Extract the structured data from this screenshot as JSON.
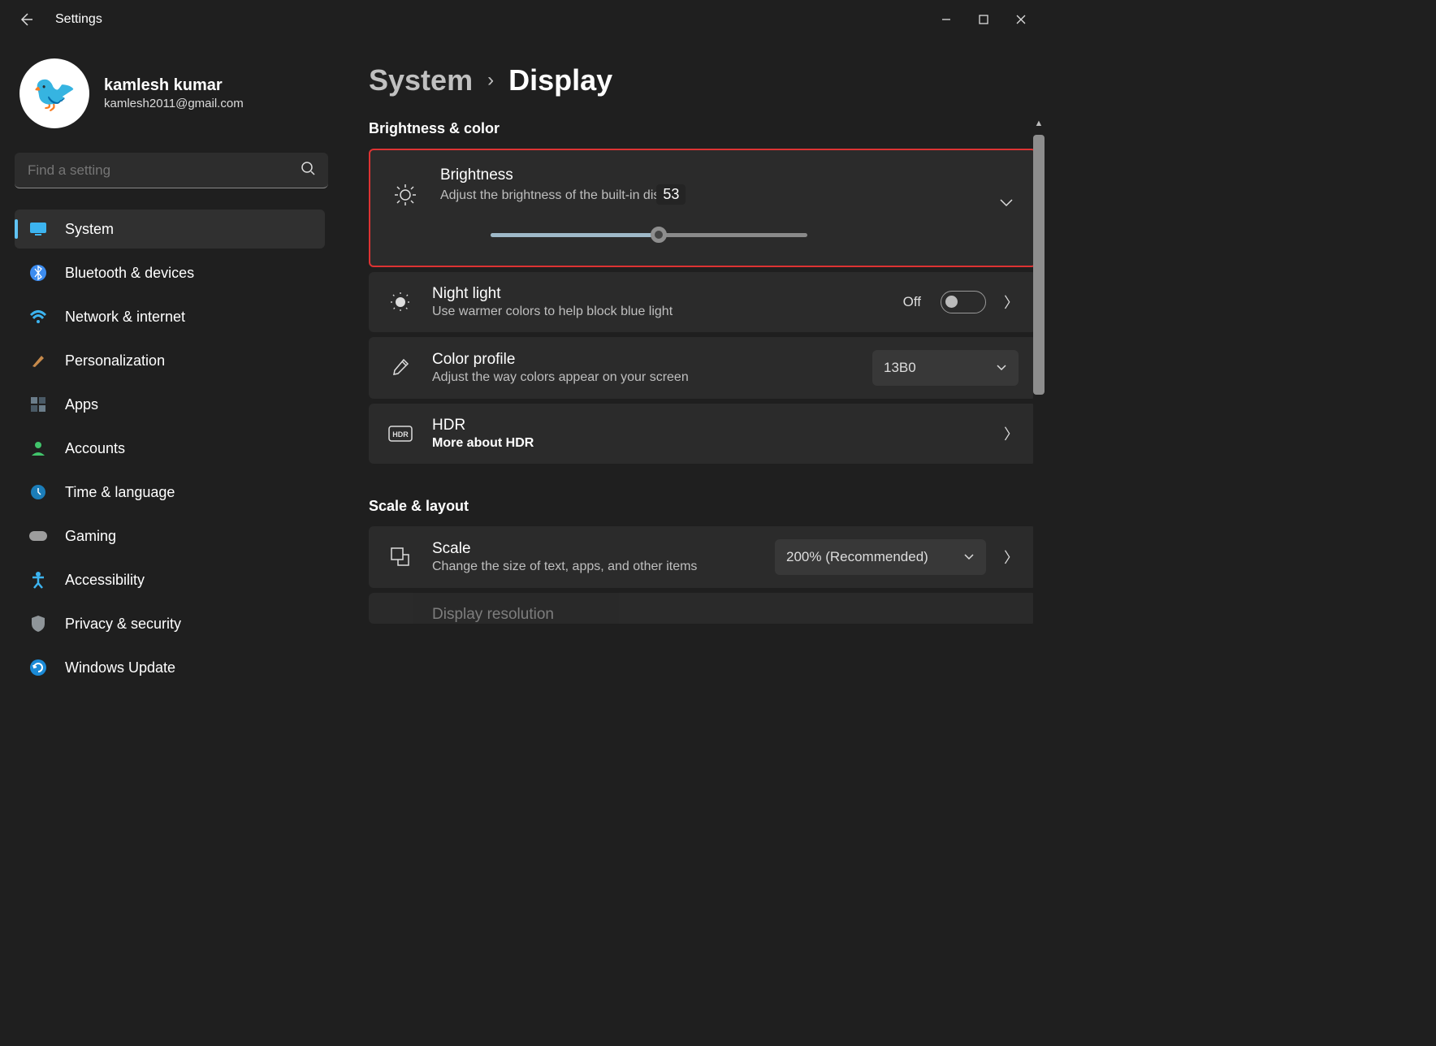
{
  "window": {
    "title": "Settings"
  },
  "user": {
    "name": "kamlesh kumar",
    "email": "kamlesh2011@gmail.com"
  },
  "search": {
    "placeholder": "Find a setting"
  },
  "nav": [
    {
      "label": "System",
      "selected": true,
      "color": "#3cb4f0"
    },
    {
      "label": "Bluetooth & devices",
      "color": "#3c8cf0"
    },
    {
      "label": "Network & internet",
      "color": "#3cb4f0"
    },
    {
      "label": "Personalization",
      "color": "#c78a4b"
    },
    {
      "label": "Apps",
      "color": "#6b7d8a"
    },
    {
      "label": "Accounts",
      "color": "#41c46b"
    },
    {
      "label": "Time & language",
      "color": "#4ba8da"
    },
    {
      "label": "Gaming",
      "color": "#9d9d9d"
    },
    {
      "label": "Accessibility",
      "color": "#3cb4f0"
    },
    {
      "label": "Privacy & security",
      "color": "#8f9599"
    },
    {
      "label": "Windows Update",
      "color": "#1b8ad6"
    }
  ],
  "breadcrumb": {
    "parent": "System",
    "current": "Display"
  },
  "sections": {
    "brightness_color": {
      "heading": "Brightness & color",
      "brightness": {
        "title": "Brightness",
        "subtitle": "Adjust the brightness of the built-in dis",
        "value": "53",
        "percent": 53
      },
      "night_light": {
        "title": "Night light",
        "subtitle": "Use warmer colors to help block blue light",
        "state_label": "Off"
      },
      "color_profile": {
        "title": "Color profile",
        "subtitle": "Adjust the way colors appear on your screen",
        "selected": "13B0"
      },
      "hdr": {
        "title": "HDR",
        "subtitle": "More about HDR"
      }
    },
    "scale_layout": {
      "heading": "Scale & layout",
      "scale": {
        "title": "Scale",
        "subtitle": "Change the size of text, apps, and other items",
        "selected": "200% (Recommended)"
      },
      "display_resolution": {
        "title": "Display resolution"
      }
    }
  }
}
